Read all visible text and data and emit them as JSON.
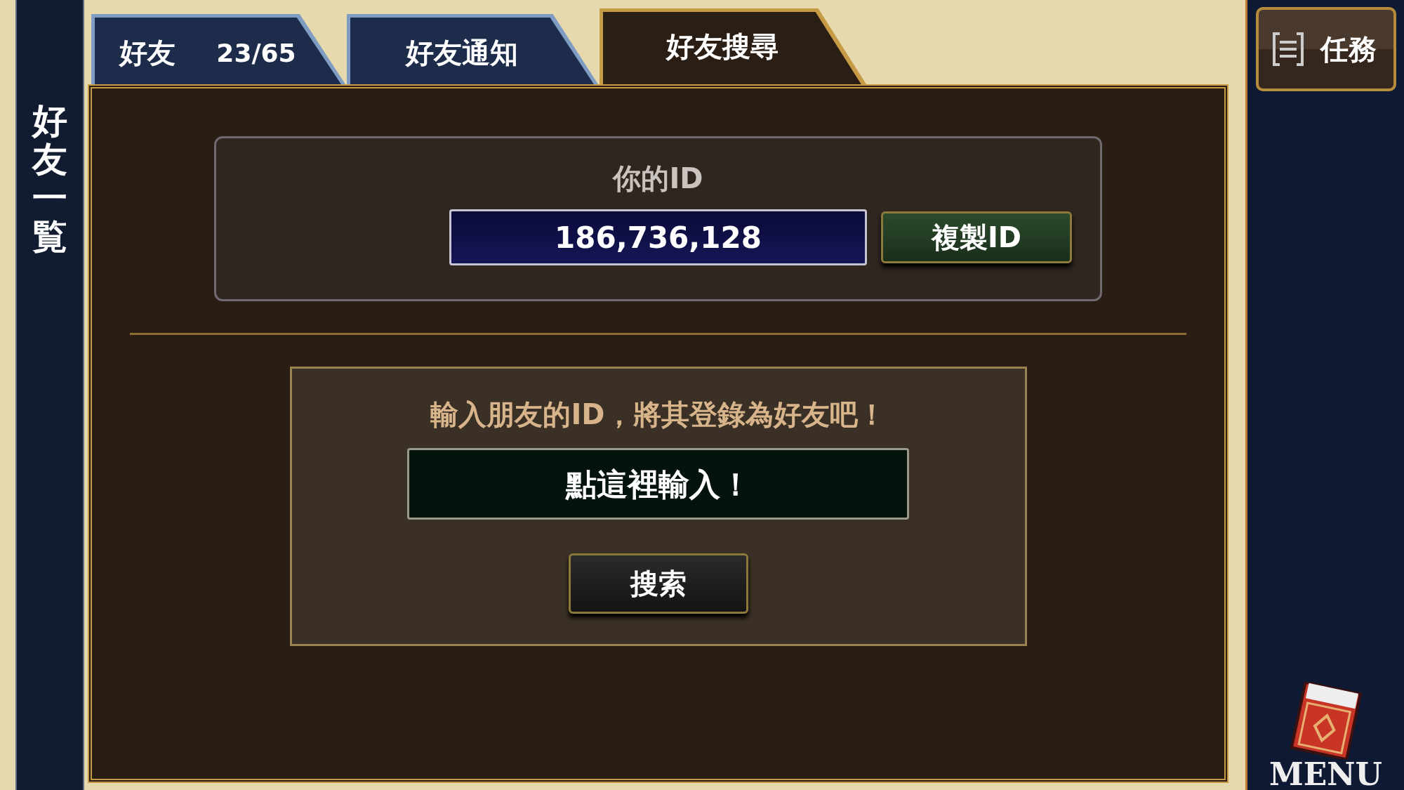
{
  "sidebar": {
    "title": "好友一覧"
  },
  "tabs": [
    {
      "label": "好友",
      "count": "23/65",
      "selected": false
    },
    {
      "label": "好友通知",
      "selected": false
    },
    {
      "label": "好友搜尋",
      "selected": true
    }
  ],
  "my_id": {
    "label": "你的ID",
    "value": "186,736,128",
    "copy_button": "複製ID"
  },
  "search": {
    "prompt": "輸入朋友的ID，將其登錄為好友吧！",
    "placeholder": "點這裡輸入！",
    "button": "搜索"
  },
  "quest_button": "任務",
  "menu_button": "MENU"
}
